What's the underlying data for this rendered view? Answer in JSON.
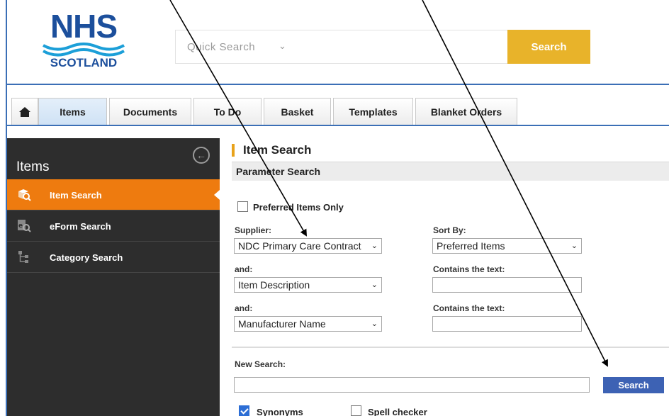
{
  "header": {
    "logo_top": "NHS",
    "logo_bottom": "SCOTLAND",
    "quick_search_placeholder": "Quick Search",
    "search_button": "Search"
  },
  "tabs": [
    {
      "label": "Items",
      "active": true
    },
    {
      "label": "Documents",
      "active": false
    },
    {
      "label": "To Do",
      "active": false
    },
    {
      "label": "Basket",
      "active": false
    },
    {
      "label": "Templates",
      "active": false
    },
    {
      "label": "Blanket Orders",
      "active": false
    }
  ],
  "sidebar": {
    "title": "Items",
    "items": [
      {
        "label": "Item Search",
        "icon": "item-search-icon",
        "active": true
      },
      {
        "label": "eForm Search",
        "icon": "eform-search-icon",
        "active": false
      },
      {
        "label": "Category Search",
        "icon": "category-tree-icon",
        "active": false
      }
    ]
  },
  "main": {
    "title": "Item Search",
    "section": "Parameter Search",
    "preferred_only_label": "Preferred Items Only",
    "preferred_only_checked": false,
    "supplier_label": "Supplier:",
    "supplier_value": "NDC Primary Care Contract",
    "sort_by_label": "Sort By:",
    "sort_by_value": "Preferred Items",
    "and_label_1": "and:",
    "field_1_value": "Item Description",
    "contains_label_1": "Contains the text:",
    "contains_value_1": "",
    "and_label_2": "and:",
    "field_2_value": "Manufacturer Name",
    "contains_label_2": "Contains the text:",
    "contains_value_2": "",
    "new_search_label": "New Search:",
    "new_search_value": "",
    "search_button": "Search",
    "synonyms_label": "Synonyms",
    "synonyms_checked": true,
    "spell_checker_label": "Spell checker",
    "spell_checker_checked": false
  },
  "colors": {
    "nhs_blue": "#1c4f9c",
    "search_gold": "#e8b32a",
    "sidebar_bg": "#2d2d2d",
    "sidebar_active": "#ee7b0f",
    "search_button_blue": "#3d62b4"
  }
}
